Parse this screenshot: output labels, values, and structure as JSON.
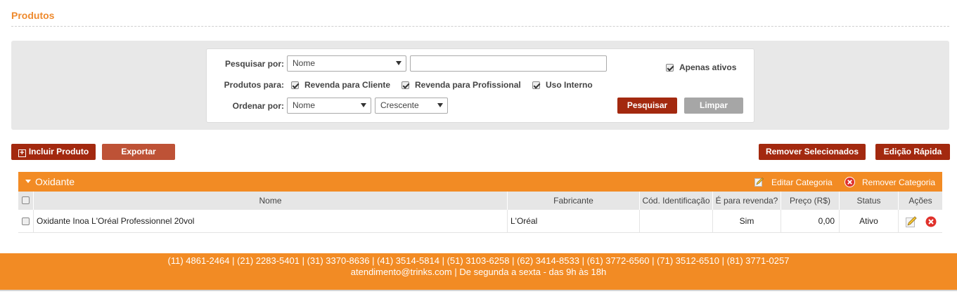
{
  "page": {
    "title": "Produtos"
  },
  "filters": {
    "search_by_label": "Pesquisar por:",
    "search_by_value": "Nome",
    "search_text_value": "",
    "active_only_label": "Apenas ativos",
    "active_only_checked": true,
    "products_for_label": "Produtos para:",
    "products_for_options": [
      {
        "label": "Revenda para Cliente",
        "checked": true
      },
      {
        "label": "Revenda para Profissional",
        "checked": true
      },
      {
        "label": "Uso Interno",
        "checked": true
      }
    ],
    "order_by_label": "Ordenar por:",
    "order_by_value": "Nome",
    "order_dir_value": "Crescente",
    "search_button": "Pesquisar",
    "clear_button": "Limpar"
  },
  "toolbar": {
    "add_product": "Incluir Produto",
    "export": "Exportar",
    "remove_selected": "Remover Selecionados",
    "quick_edit": "Edição Rápida"
  },
  "category": {
    "name": "Oxidante",
    "edit_label": "Editar Categoria",
    "remove_label": "Remover Categoria"
  },
  "table": {
    "columns": [
      "Nome",
      "Fabricante",
      "Cód. Identificação",
      "É para revenda?",
      "Preço (R$)",
      "Status",
      "Ações"
    ],
    "rows": [
      {
        "checked": false,
        "nome": "Oxidante Inoa L'Oréal Professionnel 20vol",
        "fabricante": "L'Oréal",
        "codigo": "",
        "revenda": "Sim",
        "preco": "0,00",
        "status": "Ativo"
      }
    ]
  },
  "footer": {
    "phones": "(11) 4861-2464 | (21) 2283-5401 | (31) 3370-8636 | (41) 3514-5814 | (51) 3103-6258 | (62) 3414-8533 | (61) 3772-6560 | (71) 3512-6510 | (81) 3771-0257",
    "contact": "atendimento@trinks.com  |  De segunda a sexta - das 9h às 18h"
  },
  "colors": {
    "accent_orange": "#f28b24",
    "title_orange": "#ee8a2e",
    "button_dark_red": "#a3290f",
    "button_grey": "#a6a6a6",
    "remove_icon_red": "#e0312b"
  }
}
